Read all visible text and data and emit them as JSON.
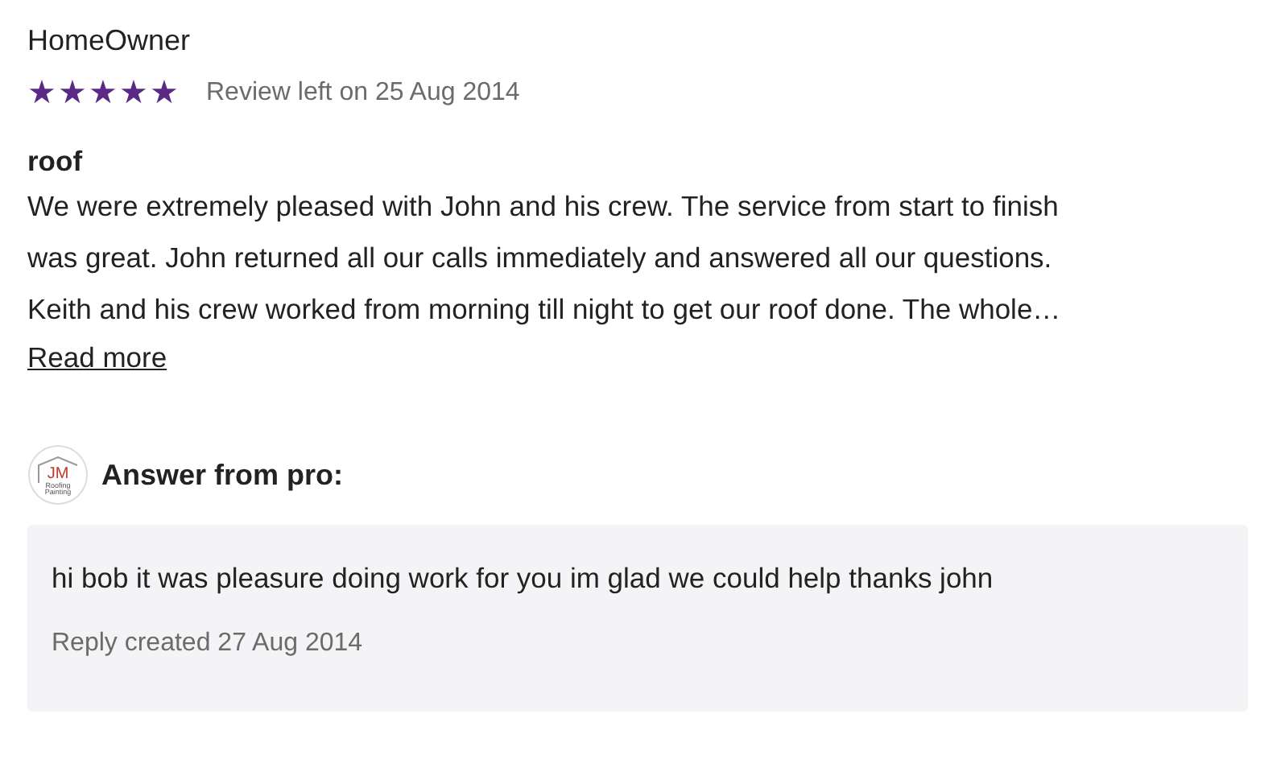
{
  "reviewer": "HomeOwner",
  "rating": {
    "stars": 5
  },
  "review_date": "Review left on 25 Aug 2014",
  "review_title": "roof",
  "review_lines": [
    "We were extremely pleased with John and his crew. The service from start to finish",
    "was great. John returned all our calls immediately and answered all our questions.",
    "Keith and his crew worked from morning till night to get our roof done. The whole…"
  ],
  "read_more": "Read more",
  "answer": {
    "logo": [
      "JM",
      "Roofing",
      "Painting"
    ],
    "heading": "Answer from pro:",
    "text": "hi bob it was pleasure doing work for you im glad we could help thanks john",
    "date": "Reply created 27 Aug 2014"
  }
}
